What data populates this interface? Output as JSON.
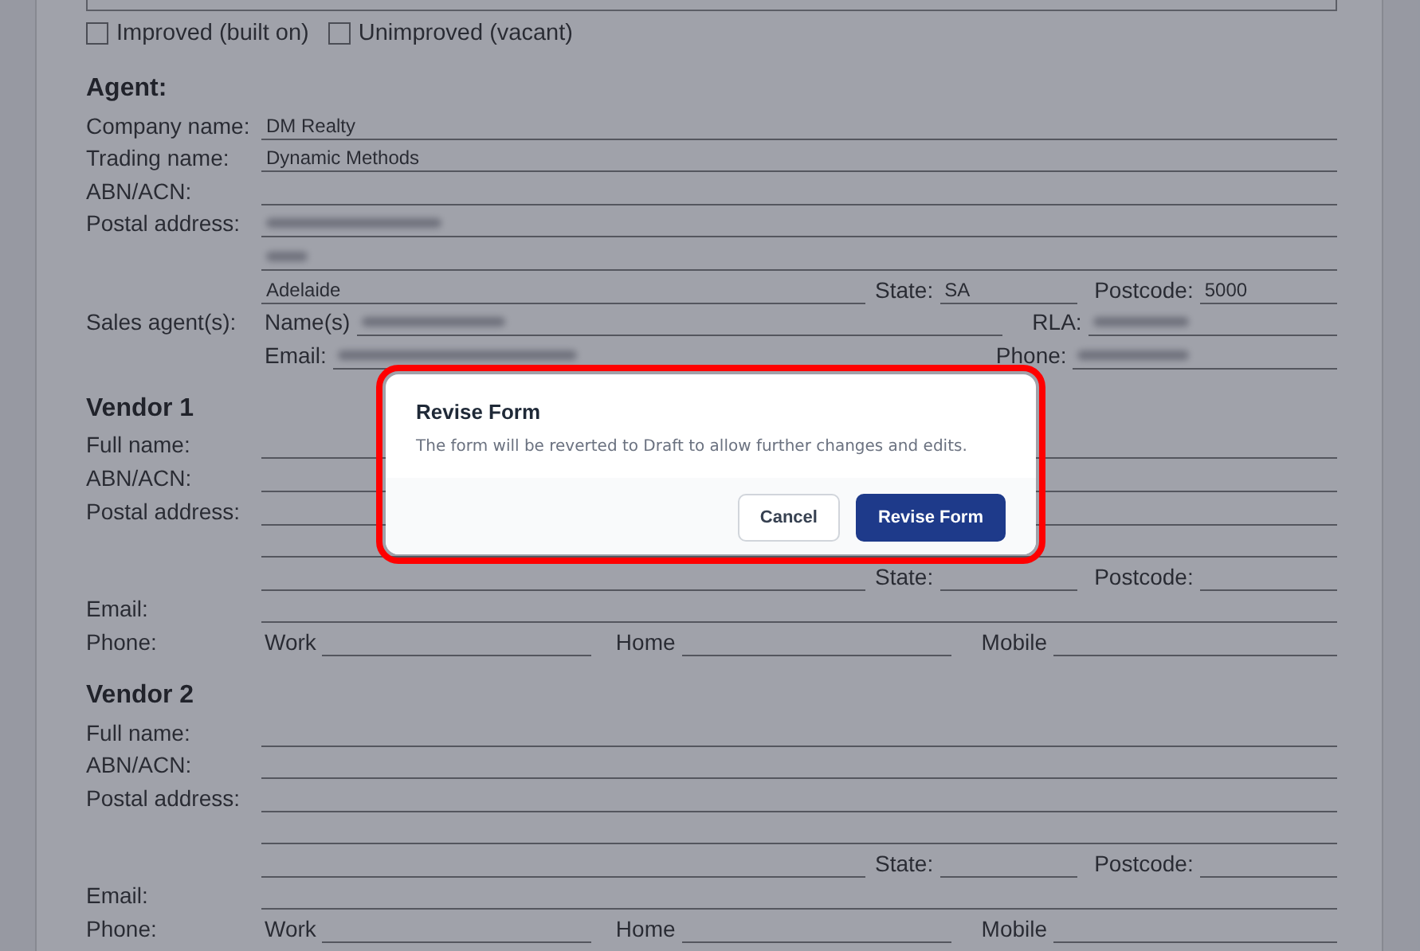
{
  "property_type": [
    {
      "label": "Improved (built on)",
      "checked": false
    },
    {
      "label": "Unimproved (vacant)",
      "checked": false
    }
  ],
  "agent": {
    "heading": "Agent:",
    "company_label": "Company name:",
    "company": "DM Realty",
    "trading_label": "Trading name:",
    "trading": "Dynamic Methods",
    "abn_label": "ABN/ACN:",
    "postal_label": "Postal address:",
    "city": "Adelaide",
    "state_label": "State:",
    "state": "SA",
    "postcode_label": "Postcode:",
    "postcode": "5000",
    "sales_label": "Sales agent(s):",
    "name_label": "Name(s)",
    "rla_label": "RLA:",
    "email_label": "Email:",
    "phone_label": "Phone:"
  },
  "vendors": [
    {
      "heading": "Vendor 1",
      "full_name_label": "Full name:",
      "abn_label": "ABN/ACN:",
      "postal_label": "Postal address:",
      "state_label": "State:",
      "postcode_label": "Postcode:",
      "email_label": "Email:",
      "phone_label": "Phone:",
      "work_label": "Work",
      "home_label": "Home",
      "mobile_label": "Mobile"
    },
    {
      "heading": "Vendor 2",
      "full_name_label": "Full name:",
      "abn_label": "ABN/ACN:",
      "postal_label": "Postal address:",
      "state_label": "State:",
      "postcode_label": "Postcode:",
      "email_label": "Email:",
      "phone_label": "Phone:",
      "work_label": "Work",
      "home_label": "Home",
      "mobile_label": "Mobile"
    }
  ],
  "dialog": {
    "title": "Revise Form",
    "message": "The form will be reverted to Draft to allow further changes and edits.",
    "highlighted": true,
    "buttons": [
      {
        "label": "Cancel",
        "kind": "secondary"
      },
      {
        "label": "Revise Form",
        "kind": "primary"
      }
    ]
  }
}
